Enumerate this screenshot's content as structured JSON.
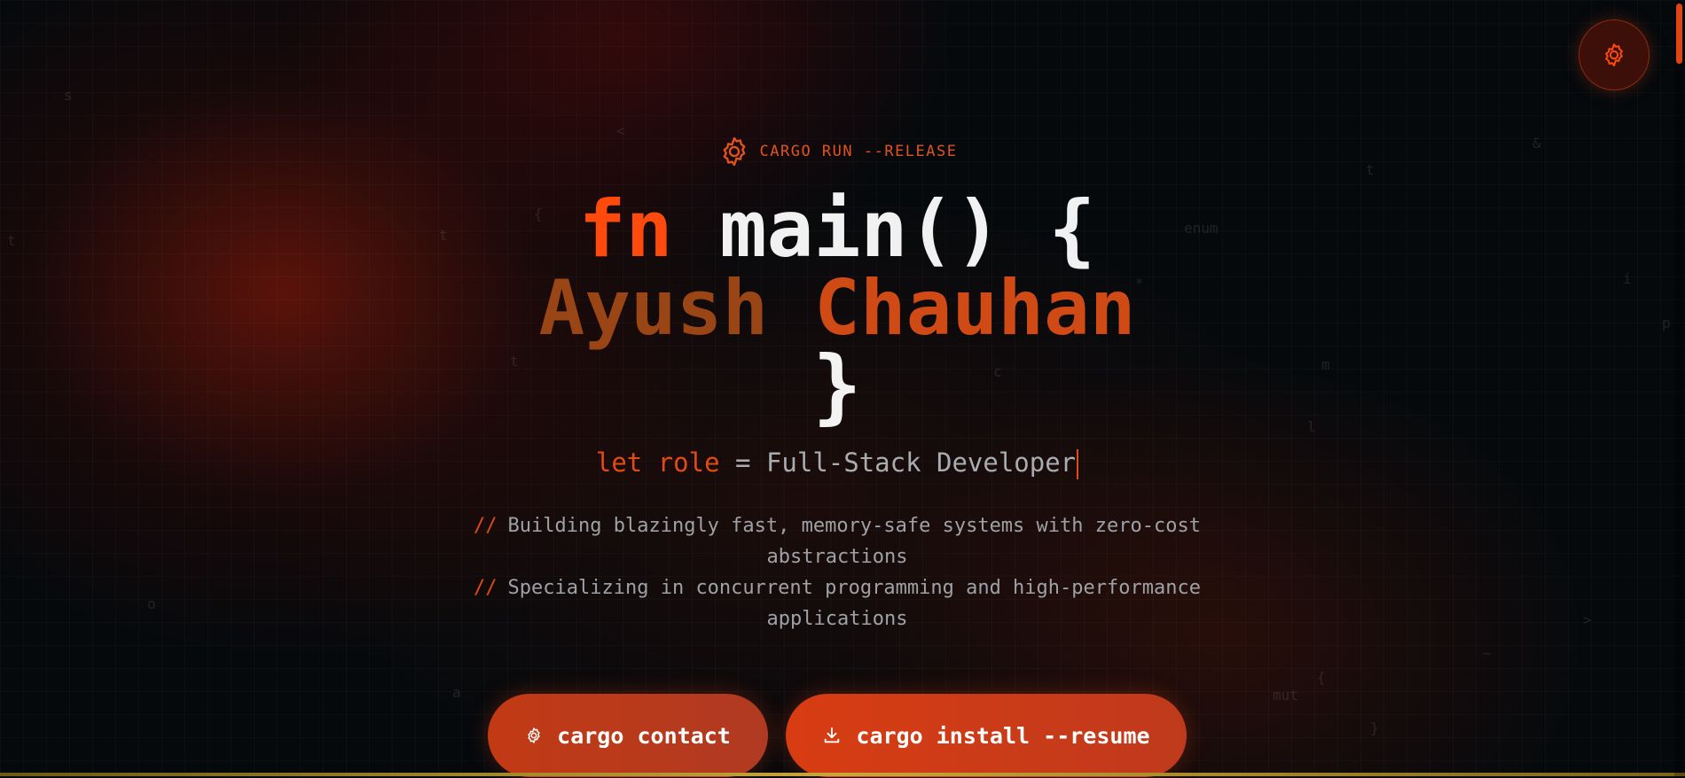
{
  "hero": {
    "tagline": "CARGO RUN --RELEASE",
    "line1_keyword": "fn",
    "line1_rest": " main() {",
    "first_name": "Ayush",
    "last_name": "Chauhan",
    "closing_brace": "}",
    "role_keyword": "let role",
    "role_equals": " = ",
    "role_value": "Full-Stack Developer",
    "desc_prefix": "//",
    "desc_line1a": "Building blazingly fast, memory-safe systems with zero-cost",
    "desc_line1b": "abstractions",
    "desc_line2a": "Specializing in concurrent programming and high-performance",
    "desc_line2b": "applications"
  },
  "buttons": {
    "contact_label": "cargo contact",
    "resume_label": "cargo install --resume"
  },
  "background_glyphs": [
    "s",
    "<",
    "{",
    "t",
    "t",
    "enum",
    "&",
    "t",
    "*",
    "i",
    "c",
    "m",
    "l",
    "o",
    ">",
    "a",
    "{",
    "mut",
    "~",
    "}",
    "p",
    "t"
  ],
  "colors": {
    "accent": "#ff4a0e",
    "name_first": "#9a4515",
    "name_last": "#cf4a14",
    "text_muted": "#9ea1a6"
  }
}
